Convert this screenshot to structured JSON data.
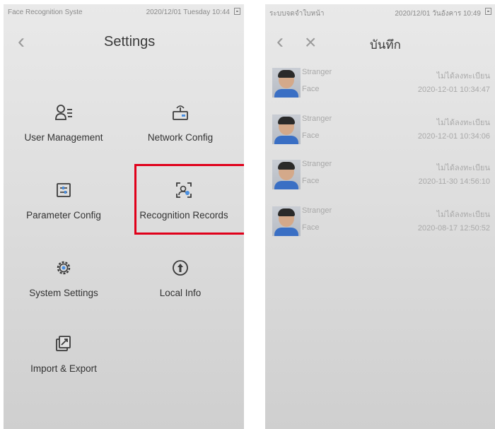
{
  "left_screen": {
    "status_bar": {
      "app_name": "Face Recognition Syste",
      "datetime": "2020/12/01 Tuesday 10:44"
    },
    "header": {
      "back_label": "‹",
      "title": "Settings"
    },
    "menu": [
      {
        "label": "User Management",
        "icon": "user-management-icon"
      },
      {
        "label": "Network Config",
        "icon": "network-config-icon"
      },
      {
        "label": "Parameter Config",
        "icon": "parameter-config-icon"
      },
      {
        "label": "Recognition Records",
        "icon": "recognition-records-icon",
        "highlighted": true
      },
      {
        "label": "System Settings",
        "icon": "system-settings-icon"
      },
      {
        "label": "Local Info",
        "icon": "local-info-icon"
      },
      {
        "label": "Import & Export",
        "icon": "import-export-icon"
      }
    ],
    "highlight_color": "#e0001a"
  },
  "right_screen": {
    "status_bar": {
      "app_name": "ระบบจดจำใบหน้า",
      "datetime": "2020/12/01 วันอังคาร 10:49"
    },
    "header": {
      "back_label": "‹",
      "close_label": "×",
      "title": "บันทึก"
    },
    "records": [
      {
        "name": "Stranger",
        "type": "Face",
        "status": "ไม่ได้ลงทะเบียน",
        "time": "2020-12-01 10:34:47"
      },
      {
        "name": "Stranger",
        "type": "Face",
        "status": "ไม่ได้ลงทะเบียน",
        "time": "2020-12-01 10:34:06"
      },
      {
        "name": "Stranger",
        "type": "Face",
        "status": "ไม่ได้ลงทะเบียน",
        "time": "2020-11-30 14:56:10"
      },
      {
        "name": "Stranger",
        "type": "Face",
        "status": "ไม่ได้ลงทะเบียน",
        "time": "2020-08-17 12:50:52"
      }
    ]
  }
}
